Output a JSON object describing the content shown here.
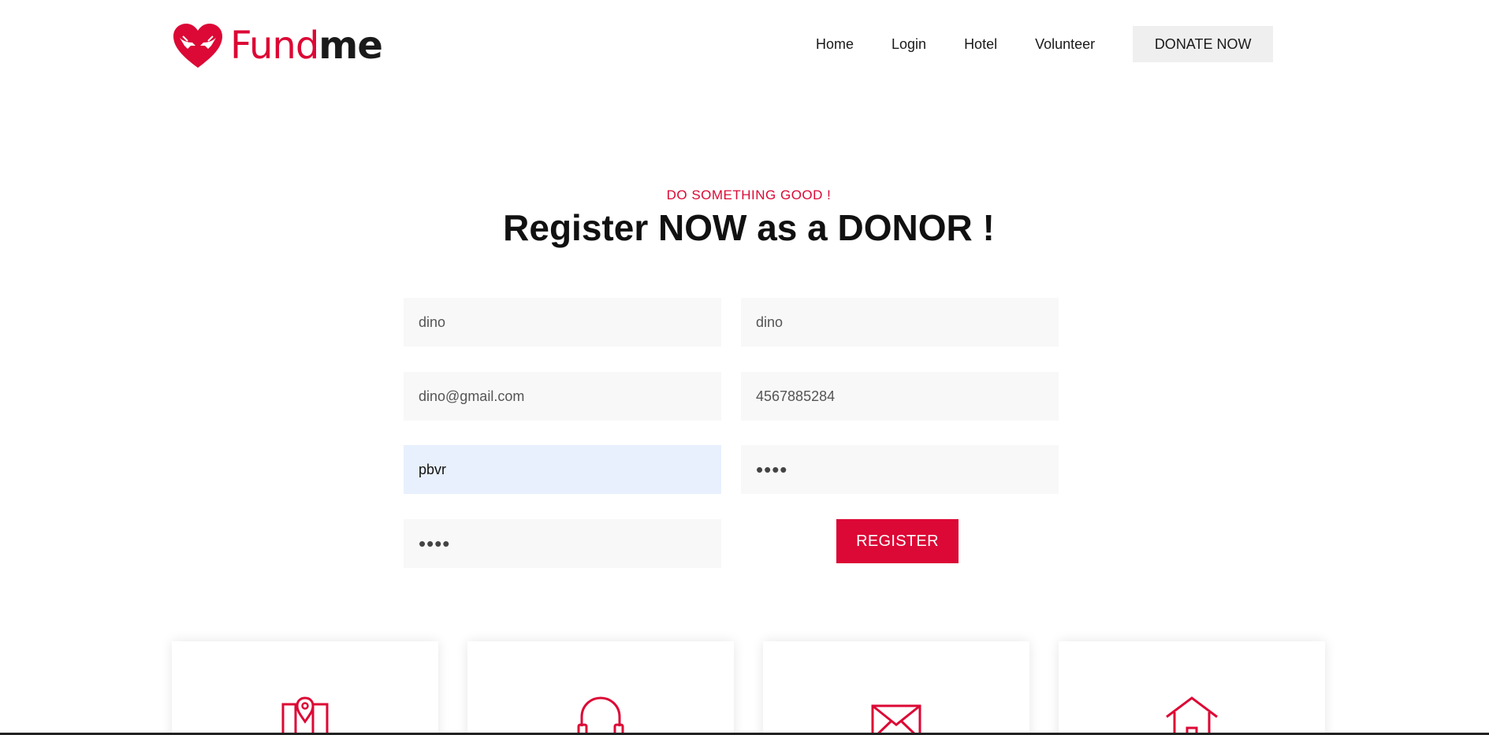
{
  "brand": {
    "name_part1": "Fund",
    "name_part2": "me",
    "icon": "heart-hands-icon",
    "accent_color": "#dc0835"
  },
  "nav": {
    "items": [
      "Home",
      "Login",
      "Hotel",
      "Volunteer"
    ],
    "cta_label": "DONATE NOW"
  },
  "hero": {
    "eyebrow": "DO SOMETHING GOOD !",
    "title": "Register NOW as a DONOR !"
  },
  "form": {
    "first_name": "dino",
    "last_name": "dino",
    "email": "dino@gmail.com",
    "phone": "4567885284",
    "address": "pbvr",
    "password": "••••",
    "confirm_password": "••••",
    "submit_label": "REGISTER"
  },
  "info_cards": [
    {
      "icon": "map-pin-icon"
    },
    {
      "icon": "headphones-icon"
    },
    {
      "icon": "envelope-icon"
    },
    {
      "icon": "home-icon"
    }
  ]
}
